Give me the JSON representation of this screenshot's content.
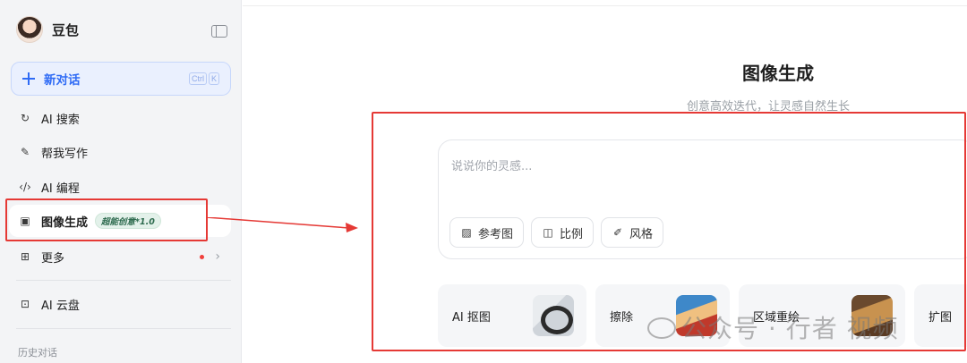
{
  "brand": {
    "name": "豆包"
  },
  "new_chat": {
    "label": "新对话",
    "shortcut": [
      "Ctrl",
      "K"
    ]
  },
  "nav": {
    "ai_search": "AI 搜索",
    "writing": "帮我写作",
    "coding": "AI 编程",
    "image": "图像生成",
    "image_badge": "超能创意*1.0",
    "more": "更多",
    "cloud": "AI 云盘"
  },
  "history_title": "历史对话",
  "main": {
    "title": "图像生成",
    "subtitle": "创意高效迭代，让灵感自然生长",
    "prompt_placeholder": "说说你的灵感...",
    "chips": {
      "reference": "参考图",
      "ratio": "比例",
      "style": "风格"
    },
    "tools": {
      "matting": "AI 抠图",
      "erase": "擦除",
      "region_redraw": "区域重绘",
      "expand": "扩图"
    }
  },
  "watermark": "公众号 · 行者 视频",
  "colors": {
    "accent": "#2f6bf5",
    "annotation": "#e53935"
  }
}
